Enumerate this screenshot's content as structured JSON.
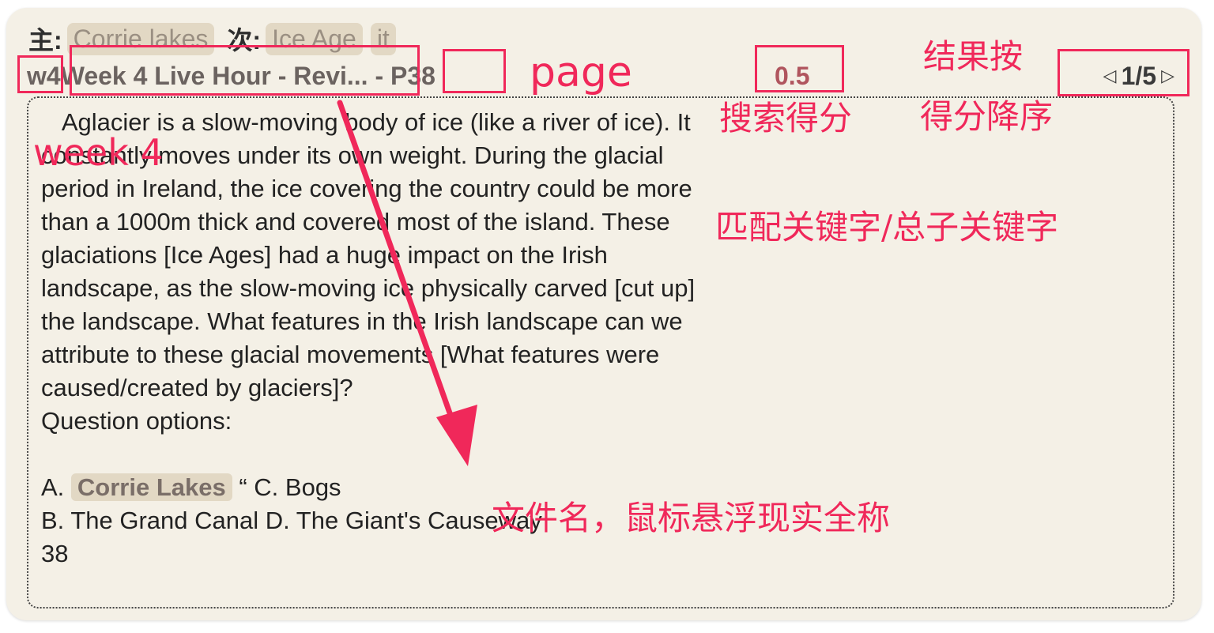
{
  "header": {
    "primary_label": "主:",
    "primary_tags": [
      "Corrie lakes"
    ],
    "secondary_label": "次:",
    "secondary_tags": [
      "Ice Age",
      "it"
    ]
  },
  "result": {
    "week_tag": "w4",
    "file_name": "Week 4 Live Hour - Revi...",
    "separator": " - ",
    "page": "P38",
    "score": "0.5",
    "pager": {
      "prev_icon": "◁",
      "current": "1/5",
      "next_icon": "▷"
    }
  },
  "content": {
    "para_before": "   Aglacier is a slow-moving body of ice (like a river of ice). It constantly moves under its own weight. During the glacial period in Ireland, the ice covering the country could be more than a 1000m thick and covered most of the island. These glaciations [Ice Ages] had a huge impact on the Irish landscape, as the slow-moving ice physically carved [cut up] the landscape. What features in the Irish landscape can we attribute to these glacial movements [What features were caused/created by glaciers]?\nQuestion options:\n\nA. ",
    "highlight": "Corrie Lakes",
    "para_after": " “ C. Bogs\nB. The Grand Canal D. The Giant's Causeway\n38"
  },
  "annotations": {
    "page": "page",
    "week": "week 4",
    "sort_line1": "结果按",
    "sort_line2": "得分降序",
    "score_note": "搜索得分",
    "match_note": "匹配关键字/总子关键字",
    "filename_note": "文件名，鼠标悬浮现实全称",
    "color": "#f0285a"
  }
}
